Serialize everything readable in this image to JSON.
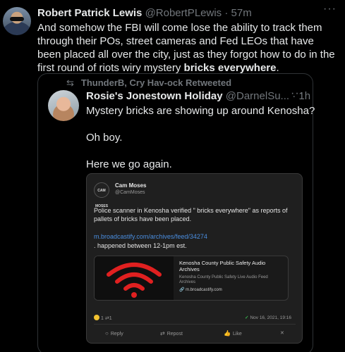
{
  "tweet": {
    "name": "Robert Patrick Lewis",
    "handle": "@RobertPLewis",
    "time": "· 57m",
    "more": "···",
    "text_main": "And somehow the FBI will come lose the ability to track them through their POs, street cameras and Fed LEOs that have been placed all over the city, just as they forgot how to do in the first round of riots wiry mystery ",
    "text_bold": "bricks everywhere",
    "text_end": "."
  },
  "retweet": {
    "icon": "⇆",
    "label": "ThunderB, Cry Hav-ock Retweeted"
  },
  "quoted": {
    "name": "Rosie's Jonestown Holiday",
    "handle": "@DarnelSu...",
    "time": "· 1h",
    "more": "···",
    "lines": [
      "Mystery bricks are showing up around Kenosha?",
      "Oh boy.",
      "Here we go again."
    ]
  },
  "screenshot": {
    "avatar_text": "CAM MOSES",
    "name": "Cam Moses",
    "handle": "@CamMoses",
    "text": "Police scanner in Kenosha verified \" bricks everywhere\" as reports of pallets of bricks have been placed.",
    "link": "m.broadcastify.com/archives/feed/34274",
    "text2": ". happened between 12-1pm est.",
    "card": {
      "title": "Kenosha County Public Safety Audio Archives",
      "desc": "Kenosha County Public Safety Live Audio Feed Archives",
      "domain": "m.broadcastify.com"
    },
    "reactions": "1 ⇄1",
    "date": "Nov 16, 2021, 19:16",
    "actions": {
      "reply": "Reply",
      "repost": "Repost",
      "like": "Like"
    }
  },
  "colors": {
    "background": "#000000",
    "text": "#e7e9ea",
    "muted": "#71767b",
    "link": "#4a8ee0",
    "accent_red": "#e02020"
  }
}
